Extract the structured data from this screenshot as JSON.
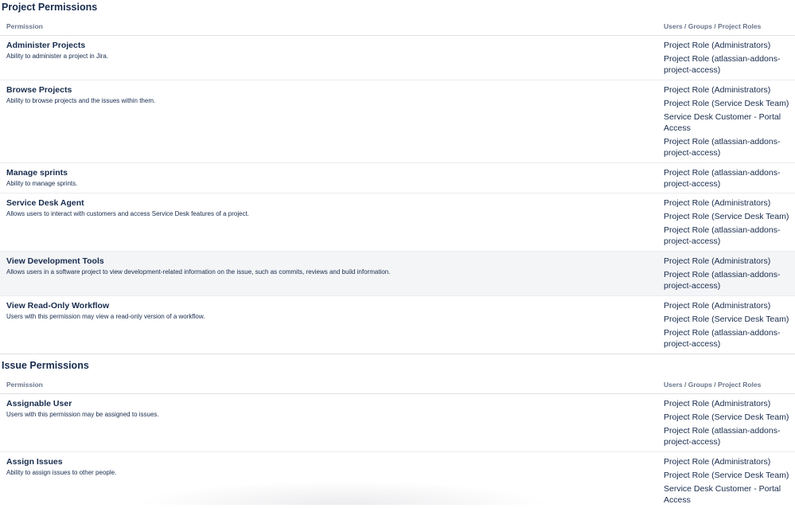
{
  "columns": {
    "permission": "Permission",
    "roles": "Users / Groups / Project Roles"
  },
  "project_section": {
    "title": "Project Permissions",
    "rows": [
      {
        "name": "Administer Projects",
        "desc": "Ability to administer a project in Jira.",
        "roles": [
          "Project Role (Administrators)",
          "Project Role (atlassian-addons-project-access)"
        ]
      },
      {
        "name": "Browse Projects",
        "desc": "Ability to browse projects and the issues within them.",
        "roles": [
          "Project Role (Administrators)",
          "Project Role (Service Desk Team)",
          "Service Desk Customer - Portal Access",
          "Project Role (atlassian-addons-project-access)"
        ]
      },
      {
        "name": "Manage sprints",
        "desc": "Ability to manage sprints.",
        "roles": [
          "Project Role (atlassian-addons-project-access)"
        ]
      },
      {
        "name": "Service Desk Agent",
        "desc": "Allows users to interact with customers and access Service Desk features of a project.",
        "roles": [
          "Project Role (Administrators)",
          "Project Role (Service Desk Team)",
          "Project Role (atlassian-addons-project-access)"
        ]
      },
      {
        "name": "View Development Tools",
        "desc": "Allows users in a software project to view development-related information on the issue, such as commits, reviews and build information.",
        "roles": [
          "Project Role (Administrators)",
          "Project Role (atlassian-addons-project-access)"
        ]
      },
      {
        "name": "View Read-Only Workflow",
        "desc": "Users with this permission may view a read-only version of a workflow.",
        "roles": [
          "Project Role (Administrators)",
          "Project Role (Service Desk Team)",
          "Project Role (atlassian-addons-project-access)"
        ]
      }
    ]
  },
  "issue_section": {
    "title": "Issue Permissions",
    "rows": [
      {
        "name": "Assignable User",
        "desc": "Users with this permission may be assigned to issues.",
        "roles": [
          "Project Role (Administrators)",
          "Project Role (Service Desk Team)",
          "Project Role (atlassian-addons-project-access)"
        ]
      },
      {
        "name": "Assign Issues",
        "desc": "Ability to assign issues to other people.",
        "roles": [
          "Project Role (Administrators)",
          "Project Role (Service Desk Team)",
          "Service Desk Customer - Portal Access"
        ]
      }
    ]
  }
}
